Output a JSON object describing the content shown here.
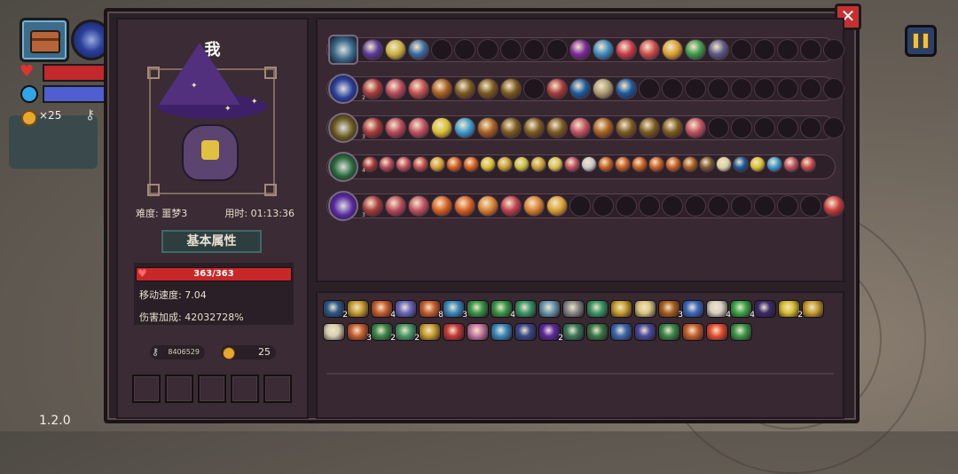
{
  "hud": {
    "coin_count": "×25",
    "version": "1.2.0"
  },
  "character": {
    "name": "我",
    "difficulty_label": "难度: 噩梦3",
    "time_label": "用时: 01:13:36",
    "section_title": "基本属性",
    "hp": "363/363",
    "move_speed": "移动速度: 7.04",
    "damage_bonus": "伤害加成: 42032728%",
    "keys": "8406529",
    "coins": "25",
    "equipment_slots": 5
  },
  "weapon_rows": [
    {
      "weapon_icon": "treasure-chest-icon",
      "weapon_color": "#3b6c8c",
      "orbs": [
        "#5a3a9a",
        "#c8b040",
        "#3a6aa0",
        "empty",
        "empty",
        "empty",
        "empty",
        "empty",
        "empty",
        "#7a2a9a",
        "#3a8ac0",
        "#c83a4a",
        "#c84a4a",
        "#d8a030",
        "#3a9a4a",
        "#5a5a8a",
        "empty",
        "empty",
        "empty",
        "empty",
        "empty"
      ],
      "levels": [
        "",
        "",
        "",
        "",
        "",
        "",
        "",
        "",
        "",
        "",
        "",
        "",
        "",
        "",
        "",
        "",
        "",
        "",
        "",
        "",
        ""
      ]
    },
    {
      "weapon_icon": "void-orb-icon",
      "weapon_color": "#2a3f9a",
      "orbs": [
        "#a83a3a",
        "#b84a5a",
        "#c05050",
        "#a86020",
        "#7a5a20",
        "#7a5a20",
        "#7a5a20",
        "empty",
        "#a83a3a",
        "#1a5aa0",
        "#a89a70",
        "#1a5aa0",
        "empty",
        "empty",
        "empty",
        "empty",
        "empty",
        "empty",
        "empty",
        "empty",
        "empty"
      ],
      "levels": [
        "2",
        "",
        "",
        "",
        "",
        "",
        "",
        "",
        "",
        "",
        "",
        "",
        "",
        "",
        "",
        "",
        "",
        "",
        "",
        "",
        ""
      ]
    },
    {
      "weapon_icon": "golden-staff-icon",
      "weapon_color": "#6a5a20",
      "orbs": [
        "#a83a3a",
        "#b84a5a",
        "#c05060",
        "#d8c030",
        "#3a9ad0",
        "#a86020",
        "#7a5a20",
        "#7a5a20",
        "#7a5a20",
        "#c05060",
        "#a86020",
        "#7a5a20",
        "#7a5a20",
        "#7a5a20",
        "#c05060",
        "empty",
        "empty",
        "empty",
        "empty",
        "empty",
        "empty"
      ],
      "levels": [
        "3",
        "",
        "",
        "",
        "",
        "",
        "",
        "",
        "",
        "",
        "",
        "",
        "",
        "",
        "",
        "",
        "",
        "",
        "",
        "",
        ""
      ]
    },
    {
      "weapon_icon": "green-wand-icon",
      "weapon_color": "#2a6a3a",
      "orbs": [
        "#a83a3a",
        "#b84a5a",
        "#c05060",
        "#c05050",
        "#d8a030",
        "#d86020",
        "#d86020",
        "#d8c030",
        "#c8a030",
        "#c8c040",
        "#c8a030",
        "#d8c050",
        "#c05060",
        "#c8c8c8",
        "#c86020",
        "#c86020",
        "#c86020",
        "#c86020",
        "#c86020",
        "#a86020",
        "#7a5a30",
        "#d8d0a0",
        "#1a5aa0",
        "#d8c030",
        "#3a9ad0",
        "#c05060",
        "#c84a4a"
      ],
      "levels": [
        "4",
        "",
        "",
        "",
        "",
        "",
        "",
        "",
        "",
        "",
        "",
        "",
        "",
        "",
        "",
        "",
        "",
        "",
        "",
        "",
        "",
        "",
        "",
        "",
        "",
        "",
        ""
      ]
    },
    {
      "weapon_icon": "purple-crystal-icon",
      "weapon_color": "#5a2aa0",
      "orbs": [
        "#a83a3a",
        "#b84a5a",
        "#c05060",
        "#d86020",
        "#d86020",
        "#d88030",
        "#c04050",
        "#d88030",
        "#d8a030",
        "empty",
        "empty",
        "empty",
        "empty",
        "empty",
        "empty",
        "empty",
        "empty",
        "empty",
        "empty",
        "empty",
        "#c83a3a"
      ],
      "levels": [
        "3",
        "",
        "",
        "",
        "",
        "",
        "",
        "",
        "",
        "",
        "",
        "",
        "",
        "",
        "",
        "",
        "",
        "",
        "",
        "",
        ""
      ]
    }
  ],
  "items": [
    {
      "name": "squid-icon",
      "color": "#2a5a8a",
      "count": "2"
    },
    {
      "name": "magnifier-icon",
      "color": "#c8a030",
      "count": ""
    },
    {
      "name": "crossbow-icon",
      "color": "#c86030",
      "count": "4"
    },
    {
      "name": "crystal-icon",
      "color": "#6a6ac0",
      "count": ""
    },
    {
      "name": "arrow-icon",
      "color": "#c86030",
      "count": "8"
    },
    {
      "name": "bow-icon",
      "color": "#3a8ac0",
      "count": "3"
    },
    {
      "name": "leaf-icon",
      "color": "#3a9a4a",
      "count": ""
    },
    {
      "name": "green-arrow-icon",
      "color": "#3a9a4a",
      "count": "4"
    },
    {
      "name": "scroll-icon",
      "color": "#3a9a6a",
      "count": ""
    },
    {
      "name": "key-icon",
      "color": "#6a9ab0",
      "count": ""
    },
    {
      "name": "shell-icon",
      "color": "#8a8a8a",
      "count": ""
    },
    {
      "name": "lamp-icon",
      "color": "#3a9a6a",
      "count": ""
    },
    {
      "name": "hand-icon",
      "color": "#c8a030",
      "count": ""
    },
    {
      "name": "bandage-icon",
      "color": "#d8c880",
      "count": ""
    },
    {
      "name": "wood-icon",
      "color": "#a86020",
      "count": "3"
    },
    {
      "name": "water-drop-icon",
      "color": "#3a6ac0",
      "count": ""
    },
    {
      "name": "claw-icon",
      "color": "#d8d0c0",
      "count": "4"
    },
    {
      "name": "clover-icon",
      "color": "#3aa84a",
      "count": "4"
    },
    {
      "name": "cape-icon",
      "color": "#3a2a6a",
      "count": ""
    },
    {
      "name": "potion-icon",
      "color": "#d8c030",
      "count": "2"
    },
    {
      "name": "hourglass-icon",
      "color": "#c8a030",
      "count": ""
    },
    {
      "name": "wing-icon",
      "color": "#d8d0b0",
      "count": ""
    },
    {
      "name": "red-crossbow-icon",
      "color": "#c86030",
      "count": "3"
    },
    {
      "name": "amulet-icon",
      "color": "#3a8a4a",
      "count": "2"
    },
    {
      "name": "lizard-icon",
      "color": "#4a9a6a",
      "count": "2"
    },
    {
      "name": "wand-icon",
      "color": "#c8a030",
      "count": ""
    },
    {
      "name": "dna-icon",
      "color": "#c83a3a",
      "count": ""
    },
    {
      "name": "brain-icon",
      "color": "#c87aa0",
      "count": ""
    },
    {
      "name": "star-icon",
      "color": "#3a8ac0",
      "count": ""
    },
    {
      "name": "rune-icon",
      "color": "#3a4a8a",
      "count": ""
    },
    {
      "name": "witch-hat-icon",
      "color": "#5a2aa0",
      "count": "2"
    },
    {
      "name": "dagger-icon",
      "color": "#3a7a5a",
      "count": ""
    },
    {
      "name": "herb-icon",
      "color": "#3a7a4a",
      "count": ""
    },
    {
      "name": "gear-icon",
      "color": "#3a6ab0",
      "count": ""
    },
    {
      "name": "gem-icon",
      "color": "#4a4aa0",
      "count": ""
    },
    {
      "name": "tail-icon",
      "color": "#3a8a4a",
      "count": ""
    },
    {
      "name": "pickaxe-icon",
      "color": "#c86030",
      "count": ""
    },
    {
      "name": "heart-icon",
      "color": "#e85030",
      "count": ""
    },
    {
      "name": "sprout-icon",
      "color": "#3a9a4a",
      "count": ""
    }
  ]
}
